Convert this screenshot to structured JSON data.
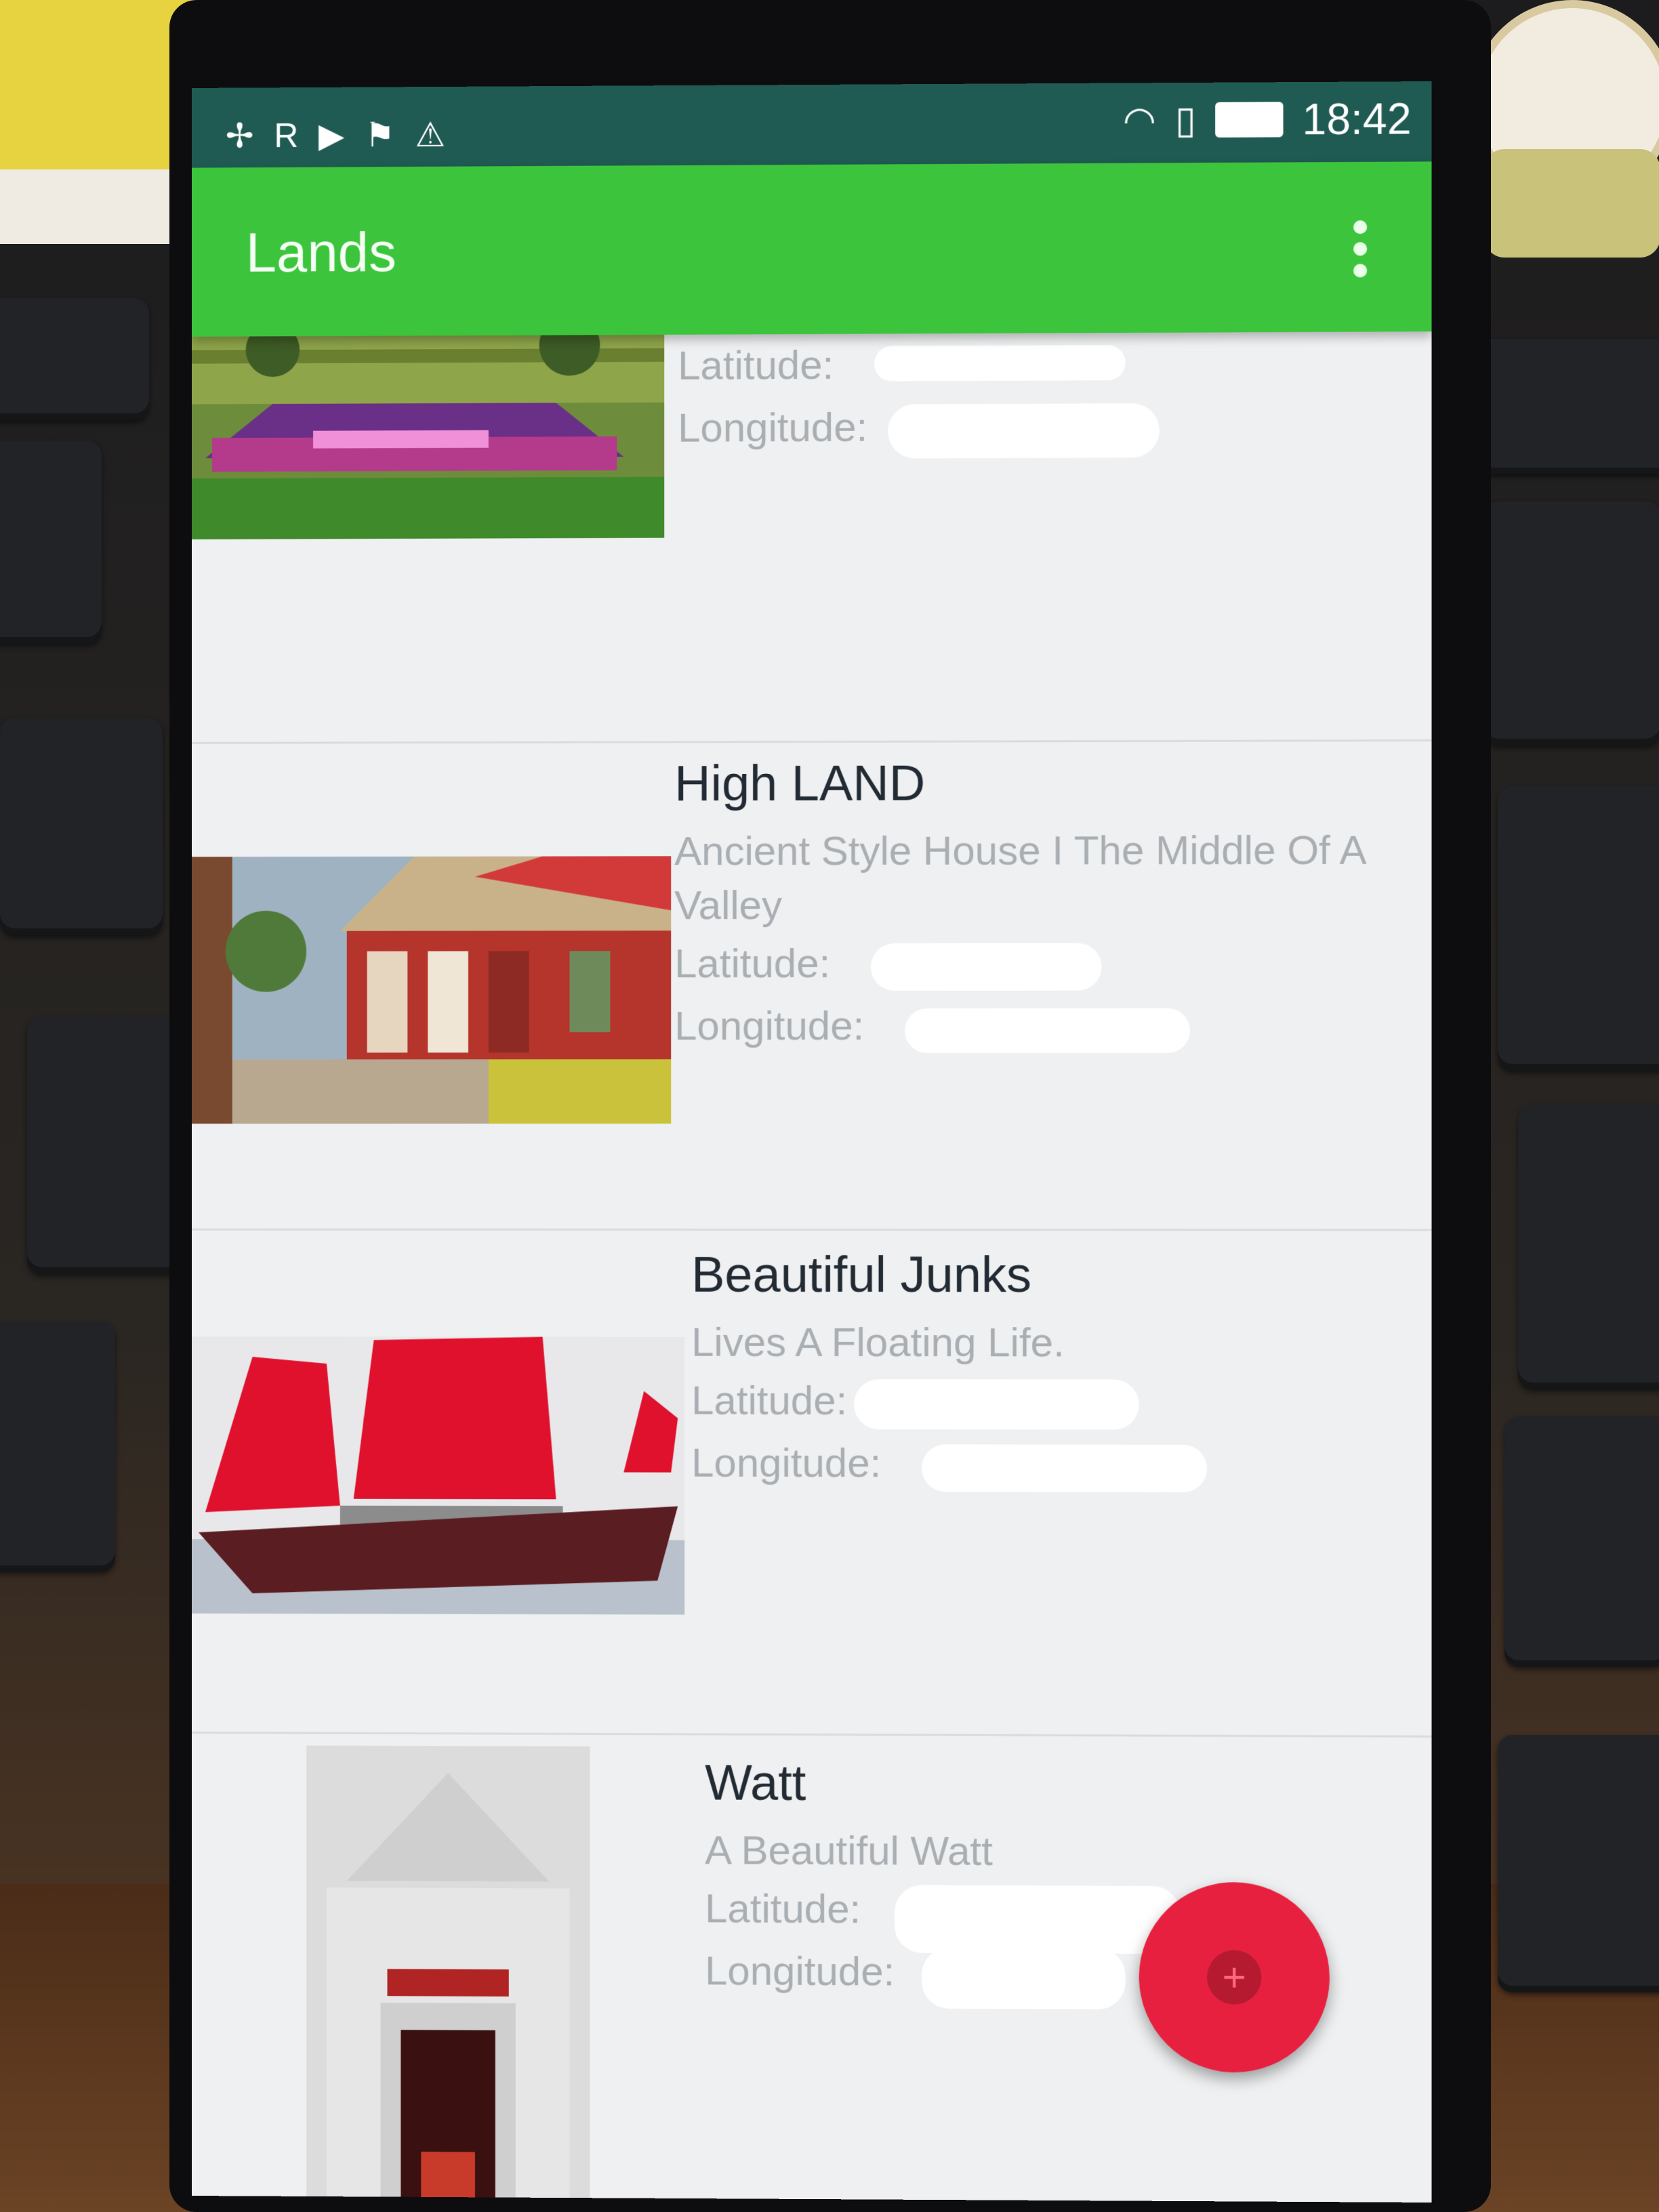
{
  "status_bar": {
    "left_icons": [
      "pinwheel-icon",
      "r-icon",
      "youtube-icon",
      "flag-icon",
      "warning-icon"
    ],
    "time": "18:42",
    "right_icons": [
      "wifi-icon",
      "sim-icon",
      "battery-icon"
    ]
  },
  "app_bar": {
    "title": "Lands",
    "overflow_icon": "more-vert-icon"
  },
  "lands": [
    {
      "name": "",
      "description": "",
      "latitude_label": "Latitude:",
      "longitude_label": "Longitude:"
    },
    {
      "name": "High LAND",
      "description": "Ancient Style House I The Middle Of A Valley",
      "latitude_label": "Latitude:",
      "longitude_label": "Longitude:"
    },
    {
      "name": "Beautiful Junks",
      "description": "Lives A Floating Life.",
      "latitude_label": "Latitude:",
      "longitude_label": "Longitude:"
    },
    {
      "name": "Watt",
      "description": "A Beautiful Watt",
      "latitude_label": "Latitude:",
      "longitude_label": "Longitude:"
    }
  ],
  "fab": {
    "icon": "add-icon"
  },
  "colors": {
    "app_bar": "#3cc53c",
    "status_bar": "#1f5b52",
    "fab": "#e8203f",
    "background": "#eef0f1"
  }
}
